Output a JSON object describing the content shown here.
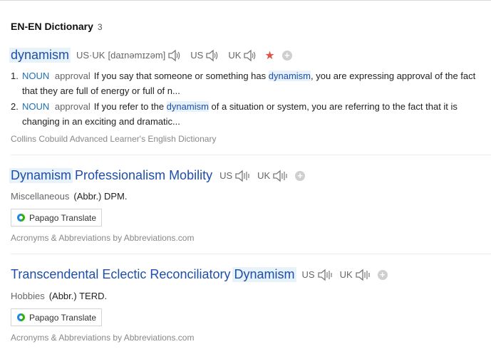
{
  "section": {
    "title": "EN-EN Dictionary",
    "count": "3"
  },
  "entry1": {
    "word": "dynamism",
    "pron_label": "US·UK",
    "pron": "[daɪnəmɪzəm]",
    "us": "US",
    "uk": "UK",
    "meanings": [
      {
        "num": "1.",
        "pos": "NOUN",
        "sense": "approval",
        "pre": "If you say that someone or something has ",
        "mark": "dynamism",
        "post": ", you are expressing approval of the fact that they are full of energy or full of n..."
      },
      {
        "num": "2.",
        "pos": "NOUN",
        "sense": "approval",
        "pre": "If you refer to the ",
        "mark": "dynamism",
        "post": " of a situation or system, you are referring to the fact that it is changing in an exciting and dramatic..."
      }
    ],
    "source": "Collins Cobuild Advanced Learner's English Dictionary"
  },
  "entry2": {
    "w1": "Dynamism",
    "w2": " Professionalism Mobility",
    "us": "US",
    "uk": "UK",
    "category": "Miscellaneous",
    "abbr": "(Abbr.) DPM.",
    "papago": "Papago Translate",
    "source": "Acronyms & Abbreviations by Abbreviations.com"
  },
  "entry3": {
    "w1": "Transcendental Eclectic Reconciliatory ",
    "w2": "Dynamism",
    "us": "US",
    "uk": "UK",
    "category": "Hobbies",
    "abbr": "(Abbr.) TERD.",
    "papago": "Papago Translate",
    "source": "Acronyms & Abbreviations by Abbreviations.com"
  },
  "icons": {
    "speaker": "speaker-icon",
    "star": "star-icon",
    "add": "add-icon",
    "papago": "papago-logo-icon"
  },
  "colors": {
    "link": "#1e4fa8",
    "highlight": "#e8f2fb",
    "star": "#e0524a"
  }
}
